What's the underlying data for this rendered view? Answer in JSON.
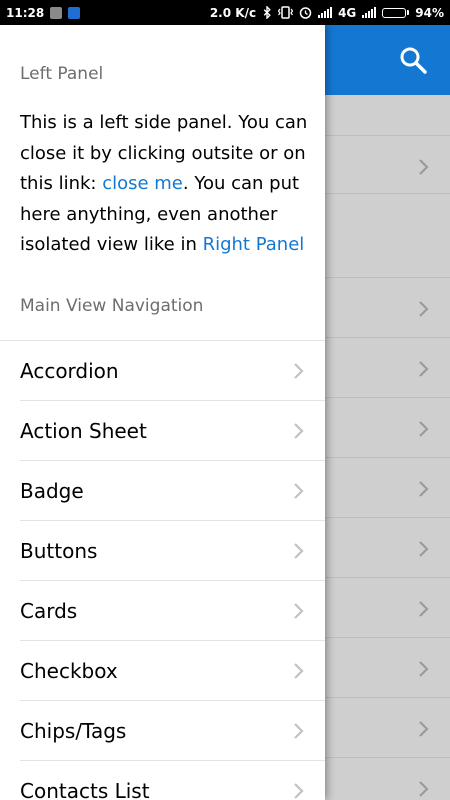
{
  "status_bar": {
    "time": "11:28",
    "network_speed": "2.0 K/c",
    "network_type": "4G",
    "battery_percent": "94%",
    "battery_level": 0.94,
    "icons": [
      "gallery-app-icon",
      "office-app-icon",
      "bluetooth-icon",
      "vibrate-icon",
      "alarm-icon",
      "signal-icon",
      "signal-icon"
    ]
  },
  "navbar": {
    "color": "#1478d2",
    "search_icon": "search-icon"
  },
  "panel": {
    "title": "Left Panel",
    "text_before_close": "This is a left side panel. You can close it by clicking outsite or on this link: ",
    "close_link": "close me",
    "text_after_close": ". You can put here anything, even another isolated view like in ",
    "right_panel_link": "Right Panel",
    "nav_heading": "Main View Navigation",
    "nav_items": [
      {
        "label": "Accordion"
      },
      {
        "label": "Action Sheet"
      },
      {
        "label": "Badge"
      },
      {
        "label": "Buttons"
      },
      {
        "label": "Cards"
      },
      {
        "label": "Checkbox"
      },
      {
        "label": "Chips/Tags"
      },
      {
        "label": "Contacts List"
      }
    ]
  },
  "colors": {
    "accent": "#1478d2",
    "overlay_background": "#cfcfcf"
  }
}
